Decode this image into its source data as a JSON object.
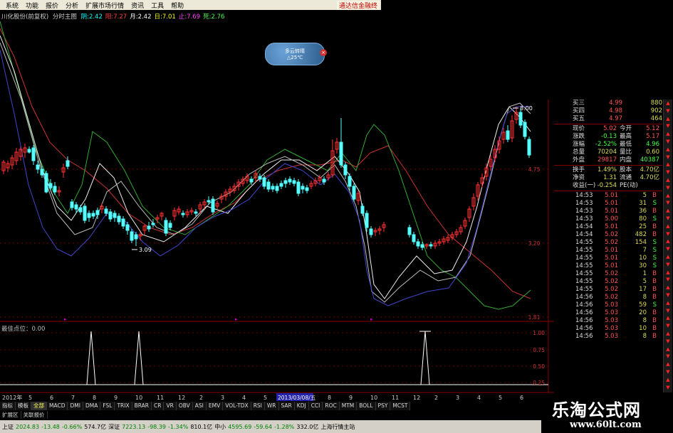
{
  "menu": {
    "items": [
      "系统",
      "功能",
      "报价",
      "分析",
      "扩展市场行情",
      "资讯",
      "工具",
      "帮助"
    ],
    "broker": "通达信金融终"
  },
  "title_line": {
    "name": "川化股份(前复权)",
    "mode": "分时主图",
    "items": [
      {
        "label": "阴",
        "value": "2.42",
        "color": "#00ffff"
      },
      {
        "label": "阳",
        "value": "7.27",
        "color": "#ff4040"
      },
      {
        "label": "月",
        "value": "2.42",
        "color": "#ffffff"
      },
      {
        "label": "日",
        "value": "7.01",
        "color": "#ffff00"
      },
      {
        "label": "止",
        "value": "7.69",
        "color": "#ff44ff"
      },
      {
        "label": "死",
        "value": "2.76",
        "color": "#44ff44"
      }
    ]
  },
  "weather": {
    "line1": "多云转晴",
    "line2": "△25℃"
  },
  "chart": {
    "price_labels": [
      "4.75",
      "3.20",
      "1.81"
    ],
    "annotations": [
      "3.09",
      "8.00"
    ],
    "indicator_title": "最佳点位：0.00",
    "indicator_ticks": [
      "1.00",
      "0.75",
      "0.50",
      "0.25"
    ]
  },
  "chart_data": {
    "type": "candlestick",
    "title": "",
    "ylim": [
      1.81,
      8.0
    ],
    "xlabel": "",
    "ylabel": "",
    "low_marker": 3.09,
    "high_marker": 8.0,
    "signal_indicator": {
      "name": "最佳点位",
      "value": 0.0,
      "ylim": [
        0,
        1
      ],
      "spikes_at_index": [
        18,
        28,
        88
      ]
    }
  },
  "quote_panel": {
    "bids": [
      {
        "label": "买三",
        "price": "4.99",
        "vol": "880"
      },
      {
        "label": "买四",
        "price": "4.98",
        "vol": "902"
      },
      {
        "label": "买五",
        "price": "4.97",
        "vol": "464"
      }
    ],
    "stats": [
      {
        "k1": "现价",
        "v1": "5.02",
        "c1": "#ff5555",
        "k2": "今开",
        "v2": "5.12",
        "c2": "#ff5555"
      },
      {
        "k1": "涨跌",
        "v1": "-0.13",
        "c1": "#44ff44",
        "k2": "最高",
        "v2": "5.17",
        "c2": "#ff5555"
      },
      {
        "k1": "涨幅",
        "v1": "-2.52%",
        "c1": "#44ff44",
        "k2": "最低",
        "v2": "4.96",
        "c2": "#44ff44"
      },
      {
        "k1": "总量",
        "v1": "70204",
        "c1": "#dddd55",
        "k2": "量比",
        "v2": "0.60",
        "c2": "#dddd55"
      },
      {
        "k1": "外盘",
        "v1": "29817",
        "c1": "#ff5555",
        "k2": "内盘",
        "v2": "40387",
        "c2": "#44ff44"
      }
    ],
    "stats2": [
      {
        "k1": "换手",
        "v1": "1.49%",
        "k2": "股本",
        "v2": "4.70亿"
      },
      {
        "k1": "净资",
        "v1": "1.31",
        "k2": "流通",
        "v2": "4.70亿"
      },
      {
        "k1": "收益(一)",
        "v1": "-0.254",
        "k2": "PE(动)",
        "v2": ""
      }
    ],
    "trades": [
      {
        "time": "14:53",
        "price": "5.01",
        "vol": "5",
        "dir": "B"
      },
      {
        "time": "14:53",
        "price": "5.01",
        "vol": "31",
        "dir": "S"
      },
      {
        "time": "14:53",
        "price": "5.01",
        "vol": "36",
        "dir": "B"
      },
      {
        "time": "14:53",
        "price": "5.00",
        "vol": "80",
        "dir": "S"
      },
      {
        "time": "14:54",
        "price": "5.01",
        "vol": "25",
        "dir": "B"
      },
      {
        "time": "14:54",
        "price": "5.02",
        "vol": "482",
        "dir": "B"
      },
      {
        "time": "14:55",
        "price": "5.02",
        "vol": "154",
        "dir": "S"
      },
      {
        "time": "14:55",
        "price": "5.01",
        "vol": "7",
        "dir": "S"
      },
      {
        "time": "14:55",
        "price": "5.01",
        "vol": "10",
        "dir": "S"
      },
      {
        "time": "14:55",
        "price": "5.01",
        "vol": "30",
        "dir": "S"
      },
      {
        "time": "14:55",
        "price": "5.02",
        "vol": "1",
        "dir": "B"
      },
      {
        "time": "14:55",
        "price": "5.02",
        "vol": "5",
        "dir": "B"
      },
      {
        "time": "14:55",
        "price": "5.02",
        "vol": "17",
        "dir": "B"
      },
      {
        "time": "14:56",
        "price": "5.02",
        "vol": "8",
        "dir": "B"
      },
      {
        "time": "14:56",
        "price": "5.03",
        "vol": "59",
        "dir": "S"
      },
      {
        "time": "14:56",
        "price": "5.03",
        "vol": "20",
        "dir": "B"
      },
      {
        "time": "14:56",
        "price": "5.03",
        "vol": "8",
        "dir": "B"
      },
      {
        "time": "14:56",
        "price": "5.03",
        "vol": "10",
        "dir": "B"
      },
      {
        "time": "14:56",
        "price": "5.03",
        "vol": "8",
        "dir": "B"
      }
    ]
  },
  "datebar": {
    "year": "2012年",
    "months": [
      "5",
      "6",
      "7",
      "8",
      "9",
      "10",
      "11",
      "12",
      "2",
      "3",
      "4",
      "5",
      "6",
      "7",
      "8",
      "9",
      "10",
      "11",
      "12",
      "2",
      "3",
      "4",
      "5",
      "6"
    ],
    "cursor": "2013/03/08/五"
  },
  "tabs": [
    "指标",
    "模板",
    "全部",
    "MACD",
    "DMI",
    "DMA",
    "FSL",
    "TRIX",
    "BRAR",
    "CR",
    "VR",
    "OBV",
    "ASI",
    "EMV",
    "VOL-TDX",
    "RSI",
    "WR",
    "SAR",
    "KDJ",
    "CCI",
    "ROC",
    "MTM",
    "BOLL",
    "PSY",
    "MCST"
  ],
  "tabs_active": "全部",
  "tabs2": [
    "扩展区",
    "关联报价"
  ],
  "status": [
    {
      "text": "上证",
      "color": "#000"
    },
    {
      "text": "2024.83",
      "color": "#008000"
    },
    {
      "text": "-13.48",
      "color": "#008000"
    },
    {
      "text": "-0.66%",
      "color": "#008000"
    },
    {
      "text": "574.7亿",
      "color": "#000"
    },
    {
      "text": "深证",
      "color": "#000"
    },
    {
      "text": "7223.13",
      "color": "#008000"
    },
    {
      "text": "-98.39",
      "color": "#008000"
    },
    {
      "text": "-1.34%",
      "color": "#008000"
    },
    {
      "text": "810.1亿",
      "color": "#000"
    },
    {
      "text": "中小",
      "color": "#000"
    },
    {
      "text": "4595.69",
      "color": "#008000"
    },
    {
      "text": "-59.64",
      "color": "#008000"
    },
    {
      "text": "-1.28%",
      "color": "#008000"
    },
    {
      "text": "332.0亿",
      "color": "#000"
    },
    {
      "text": "上海行情主站",
      "color": "#000"
    }
  ],
  "watermark": {
    "name": "乐淘公式网",
    "url": "www.60lt.com"
  }
}
